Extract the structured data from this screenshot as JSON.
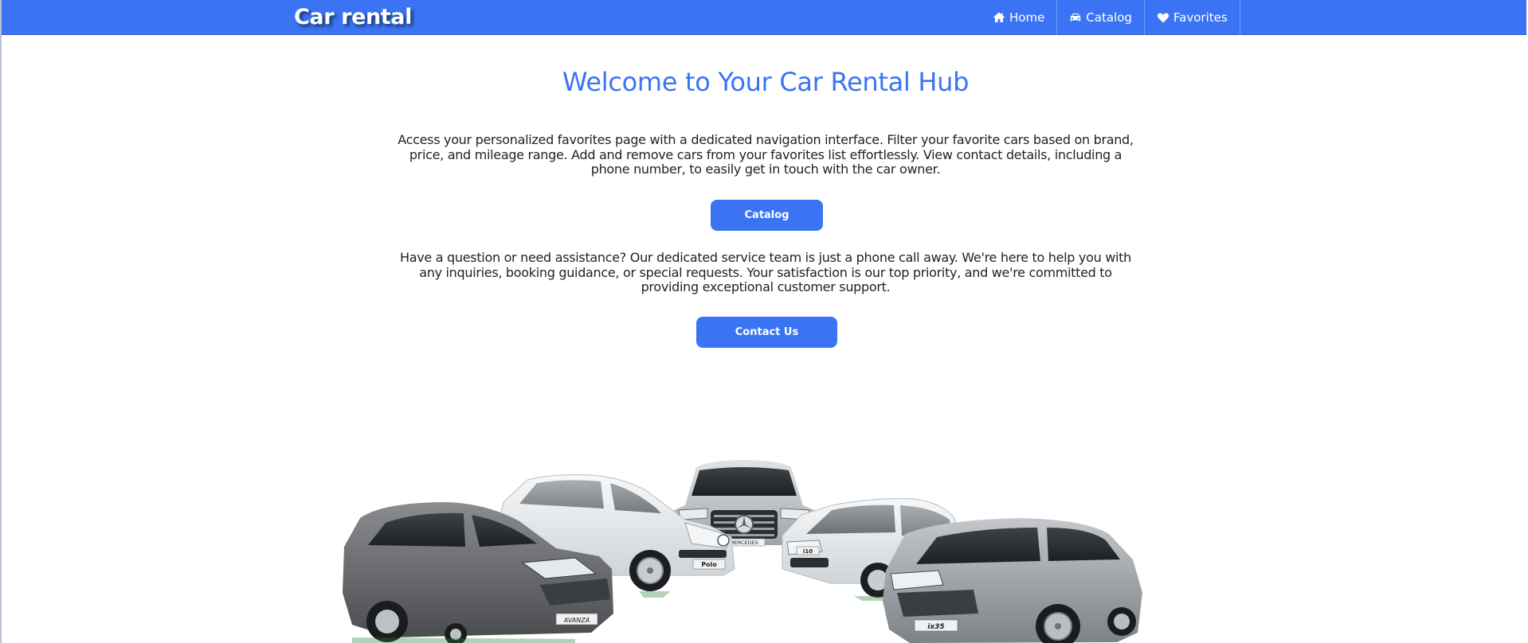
{
  "header": {
    "brand": "Car rental",
    "nav": [
      {
        "label": "Home",
        "icon": "home-icon"
      },
      {
        "label": "Catalog",
        "icon": "car-icon"
      },
      {
        "label": "Favorites",
        "icon": "heart-icon"
      }
    ]
  },
  "main": {
    "title": "Welcome to Your Car Rental Hub",
    "intro": "Access your personalized favorites page with a dedicated navigation interface. Filter your favorite cars based on brand, price, and mileage range. Add and remove cars from your favorites list effortlessly. View contact details, including a phone number, to easily get in touch with the car owner.",
    "catalog_button": "Catalog",
    "support": "Have a question or need assistance? Our dedicated service team is just a phone call away. We're here to help you with any inquiries, booking guidance, or special requests. Your satisfaction is our top priority, and we're committed to providing exceptional customer support.",
    "contact_button": "Contact Us"
  },
  "cars_image": {
    "plates": [
      "Polo",
      "i10",
      "ix35",
      "AVANZA",
      "MERCEDES"
    ]
  },
  "colors": {
    "accent": "#3a74f4",
    "text": "#222222",
    "background": "#ffffff"
  }
}
